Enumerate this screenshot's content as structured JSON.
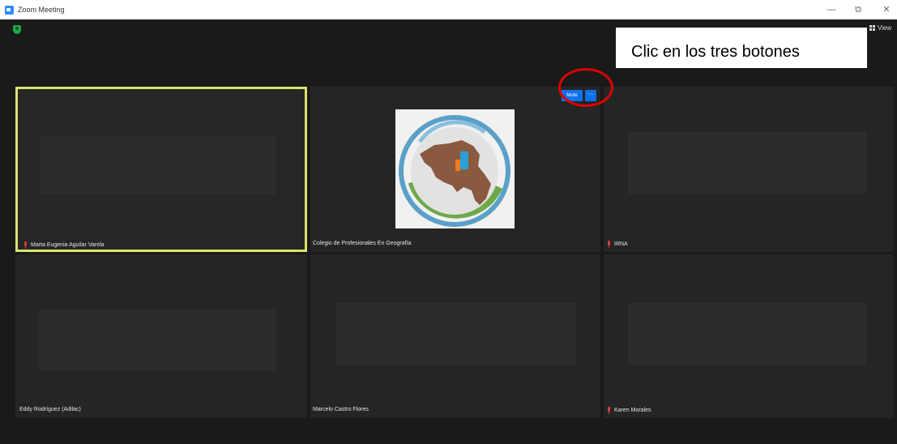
{
  "window": {
    "title": "Zoom Meeting",
    "minimize": "—",
    "maximize": "⧉",
    "close": "✕"
  },
  "toolbar": {
    "view_label": "View"
  },
  "annotation": {
    "text": "Clic en los tres botones",
    "circle_color": "#e00000"
  },
  "controls": {
    "mute_label": "Mute",
    "more_label": "···"
  },
  "participants": [
    {
      "name": "Marta Eugenia Aguilar Varela",
      "muted": true,
      "active_speaker": true
    },
    {
      "name": "Colegio de Profesionales En Geografía",
      "muted": false,
      "has_picture": true
    },
    {
      "name": "IRNA",
      "muted": true
    },
    {
      "name": "Eddy Rodríguez (Adilac)",
      "muted": false
    },
    {
      "name": "Marcelo Castro Flores",
      "muted": false
    },
    {
      "name": "Karen Morales",
      "muted": true
    }
  ],
  "colors": {
    "accent": "#0e71eb",
    "active_speaker_border": "#d9e36f",
    "muted_icon": "#e03a3a",
    "background": "#1a1a1a"
  }
}
